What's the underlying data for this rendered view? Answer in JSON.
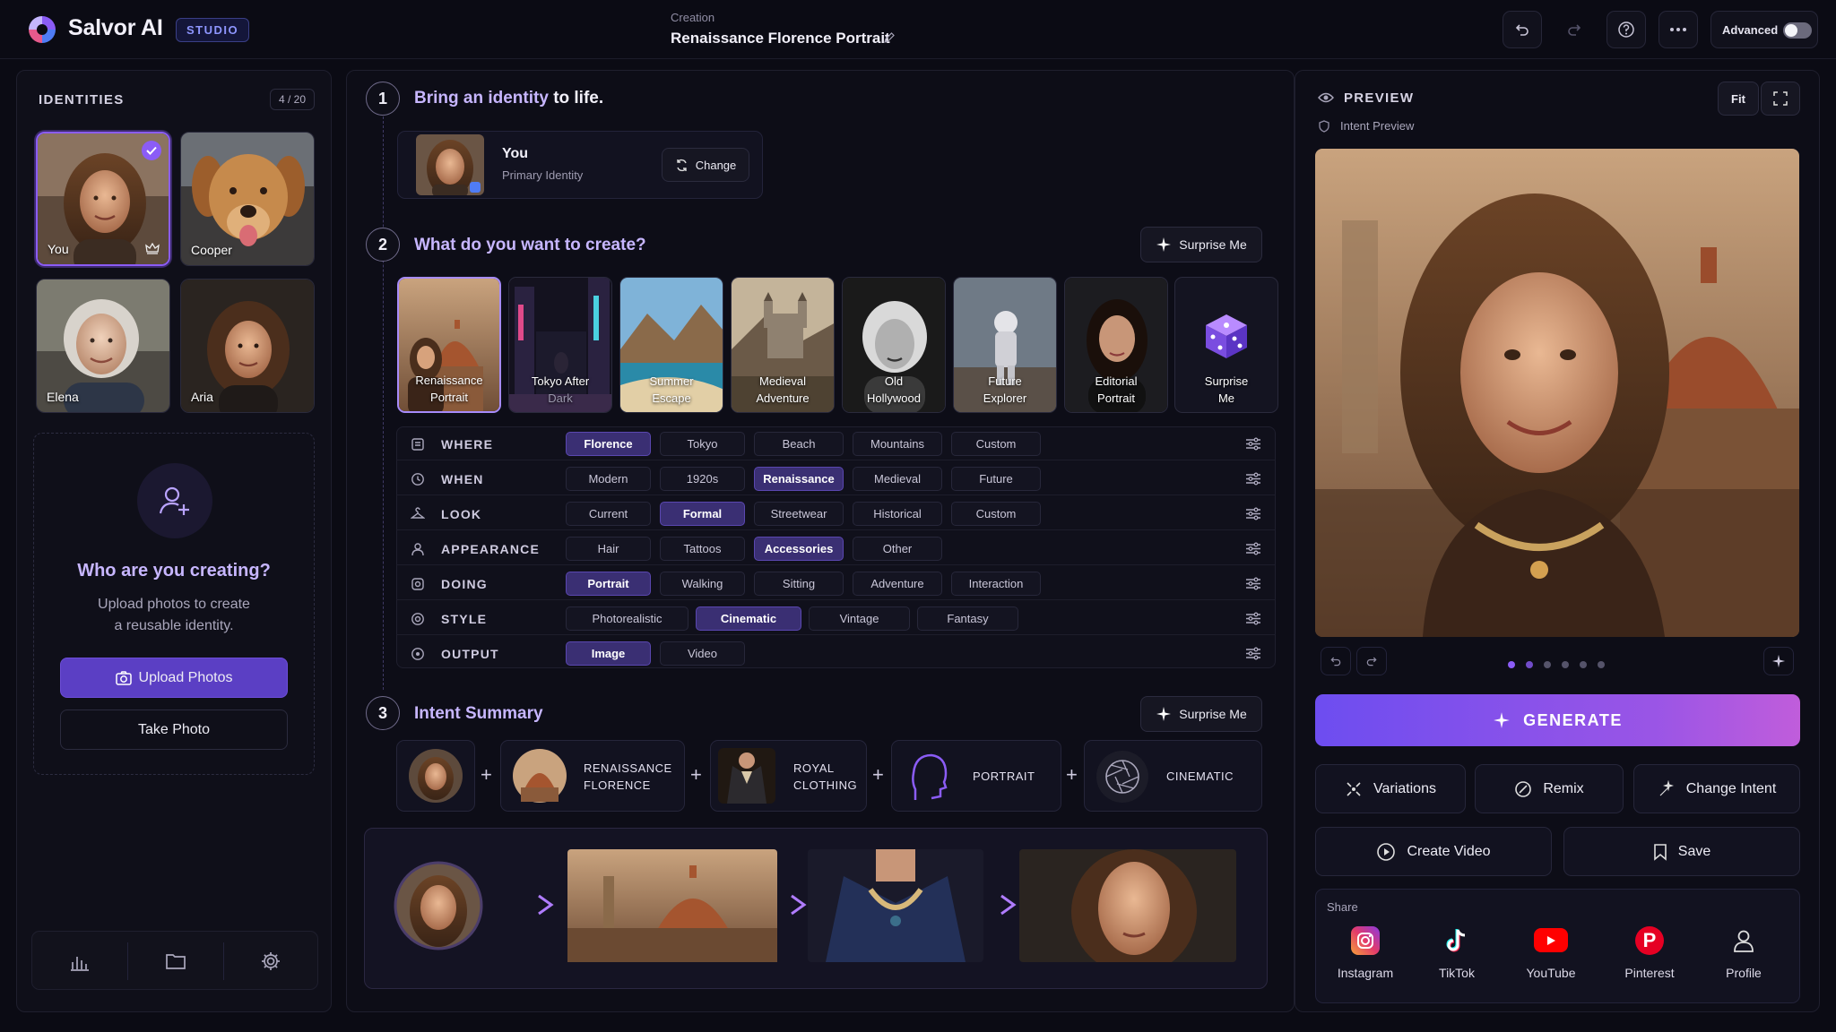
{
  "app": {
    "name": "Salvor AI",
    "badge": "STUDIO"
  },
  "header": {
    "crumb": "Creation",
    "title": "Renaissance Florence Portrait",
    "advanced_label": "Advanced"
  },
  "identities": {
    "title": "IDENTITIES",
    "count": "4 / 20",
    "items": [
      {
        "name": "You"
      },
      {
        "name": "Cooper"
      },
      {
        "name": "Elena"
      },
      {
        "name": "Aria"
      }
    ],
    "empty_title": "Who are you creating?",
    "empty_desc_1": "Upload photos to create",
    "empty_desc_2": "a reusable identity.",
    "upload_label": "Upload Photos",
    "take_label": "Take Photo"
  },
  "step1": {
    "num": "1",
    "title_a": "Bring an identity",
    "title_b": "to life.",
    "identity_name": "You",
    "identity_role": "Primary Identity",
    "change_label": "Change"
  },
  "step2": {
    "num": "2",
    "title": "What do you want to create?",
    "surprise_label": "Surprise Me",
    "templates": [
      {
        "l1": "Renaissance",
        "l2": "Portrait"
      },
      {
        "l1": "Tokyo After",
        "l2": "Dark"
      },
      {
        "l1": "Summer",
        "l2": "Escape"
      },
      {
        "l1": "Medieval",
        "l2": "Adventure"
      },
      {
        "l1": "Old",
        "l2": "Hollywood"
      },
      {
        "l1": "Future",
        "l2": "Explorer"
      },
      {
        "l1": "Editorial",
        "l2": "Portrait"
      },
      {
        "l1": "Surprise",
        "l2": "Me"
      }
    ],
    "rows": [
      {
        "label": "WHERE",
        "chips": [
          "Florence",
          "Tokyo",
          "Beach",
          "Mountains",
          "Custom"
        ]
      },
      {
        "label": "WHEN",
        "chips": [
          "Modern",
          "1920s",
          "Renaissance",
          "Medieval",
          "Future"
        ]
      },
      {
        "label": "LOOK",
        "chips": [
          "Current",
          "Formal",
          "Streetwear",
          "Historical",
          "Custom"
        ]
      },
      {
        "label": "APPEARANCE",
        "chips": [
          "Hair",
          "Tattoos",
          "Accessories",
          "Other"
        ]
      },
      {
        "label": "DOING",
        "chips": [
          "Portrait",
          "Walking",
          "Sitting",
          "Adventure",
          "Interaction"
        ]
      },
      {
        "label": "STYLE",
        "chips": [
          "Photorealistic",
          "Cinematic",
          "Vintage",
          "Fantasy"
        ]
      },
      {
        "label": "OUTPUT",
        "chips": [
          "Image",
          "Video"
        ]
      }
    ]
  },
  "step3": {
    "num": "3",
    "title": "Intent Summary",
    "surprise_label": "Surprise Me",
    "items": [
      {
        "l1": "RENAISSANCE",
        "l2": "FLORENCE"
      },
      {
        "l1": "ROYAL",
        "l2": "CLOTHING"
      },
      {
        "l1": "PORTRAIT",
        "l2": ""
      },
      {
        "l1": "CINEMATIC",
        "l2": ""
      }
    ]
  },
  "preview": {
    "title": "PREVIEW",
    "fit_label": "Fit",
    "sub": "Intent Preview",
    "generate_label": "GENERATE",
    "actions": [
      "Variations",
      "Remix",
      "Change Intent"
    ],
    "create_video": "Create Video",
    "save": "Save",
    "share_title": "Share",
    "share": [
      "Instagram",
      "TikTok",
      "YouTube",
      "Pinterest",
      "Profile"
    ]
  },
  "colors": {
    "accent": "#8b5cf6",
    "generate_from": "#6d4df0",
    "generate_to": "#b05ce0"
  }
}
